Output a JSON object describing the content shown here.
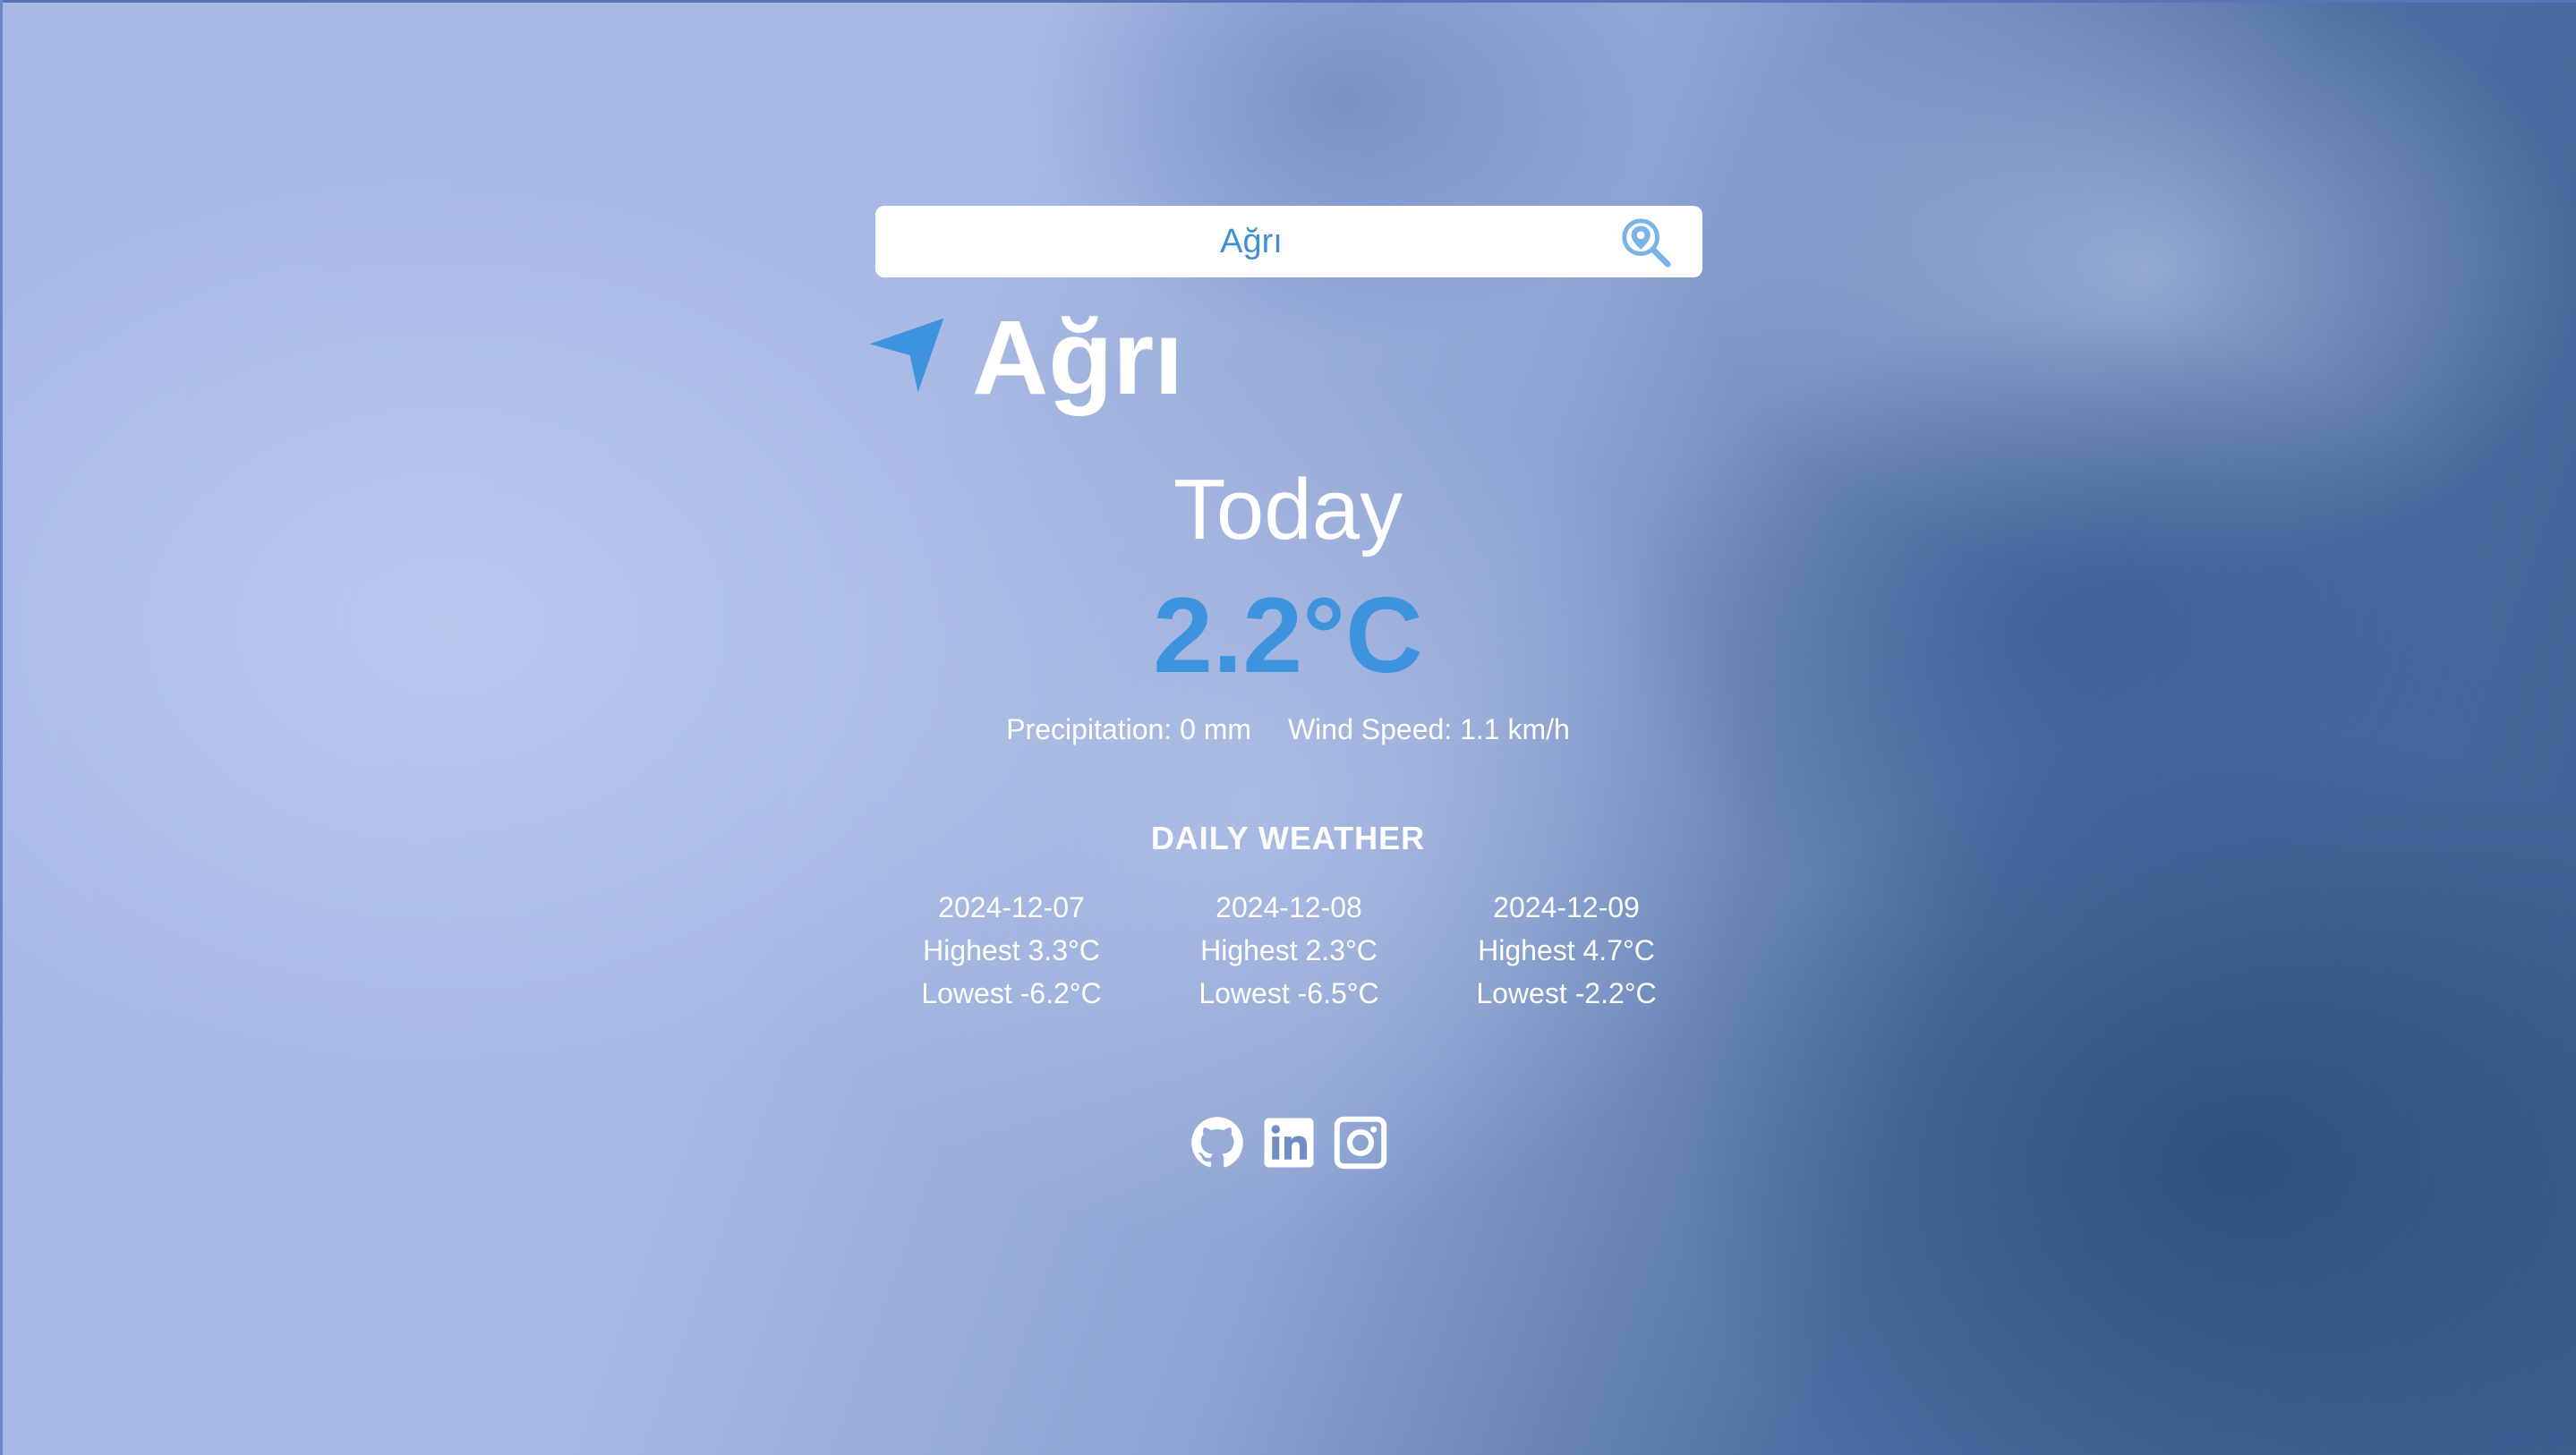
{
  "search": {
    "value": "Ağrı",
    "icon": "location-search-icon"
  },
  "location": {
    "icon": "navigation-arrow-icon",
    "city": "Ağrı"
  },
  "current": {
    "label": "Today",
    "temperature": "2.2°C",
    "precipitation": "Precipitation: 0 mm",
    "wind_speed": "Wind Speed: 1.1 km/h"
  },
  "daily": {
    "title": "DAILY WEATHER",
    "days": [
      {
        "date": "2024-12-07",
        "highest": "Highest 3.3°C",
        "lowest": "Lowest -6.2°C"
      },
      {
        "date": "2024-12-08",
        "highest": "Highest 2.3°C",
        "lowest": "Lowest -6.5°C"
      },
      {
        "date": "2024-12-09",
        "highest": "Highest 4.7°C",
        "lowest": "Lowest -2.2°C"
      }
    ]
  },
  "social": {
    "icons": [
      "github-icon",
      "linkedin-icon",
      "instagram-icon"
    ]
  },
  "colors": {
    "accent": "#3d93dd",
    "text": "#ffffff",
    "search_bg": "#ffffff"
  }
}
